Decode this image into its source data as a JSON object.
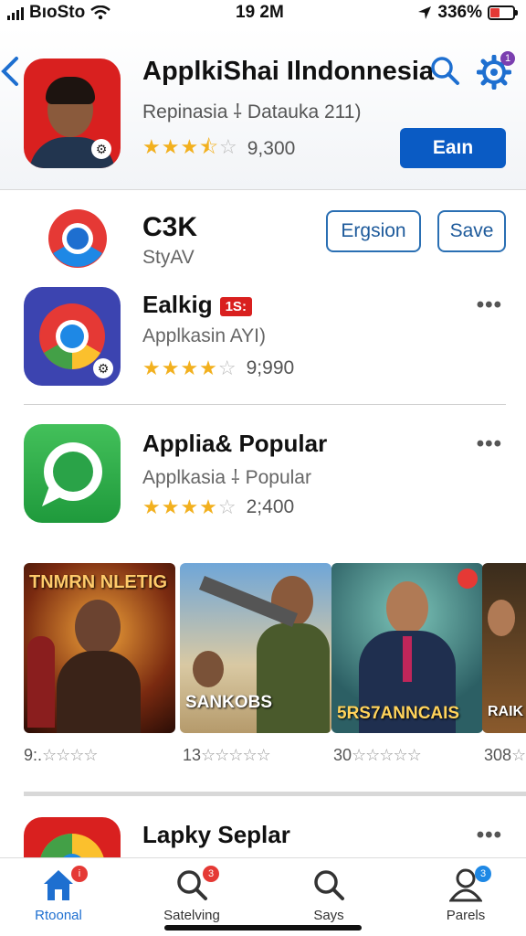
{
  "status_bar": {
    "carrier": "BıoSto",
    "time": "19 2M",
    "battery": "336%"
  },
  "header": {
    "title": "ApplkiShai Ilndonnesia",
    "subtitle": "Repinasia ⸸ Datauka 211)",
    "rating_count": "9,300",
    "stars": 3.5,
    "primary_button": "Eaın",
    "settings_badge": "1"
  },
  "row_chrome": {
    "title": "C3K",
    "subtitle": "StyAV",
    "button_1": "Ergsion",
    "button_2": "Save"
  },
  "row_1": {
    "title": "Ealkig",
    "tag": "1S:",
    "subtitle": "Applkasin AYI)",
    "stars": 4,
    "rating_count": "9;990",
    "more": "•••"
  },
  "row_2": {
    "title": "Applia& Popular",
    "subtitle": "Applkasia ⸸ Popular",
    "stars": 4,
    "rating_count": "2;400",
    "more": "•••"
  },
  "carousel": [
    {
      "top_caption": "TNMRN NLETIG",
      "caption": "",
      "rating_prefix": "9:.",
      "rating_stars": "☆☆☆☆"
    },
    {
      "top_caption": "",
      "caption": "SANKOBS",
      "rating_prefix": "13",
      "rating_stars": "☆☆☆☆☆"
    },
    {
      "top_caption": "",
      "caption": "5RS7ANNCAIS",
      "rating_prefix": "30",
      "rating_stars": "☆☆☆☆☆"
    },
    {
      "top_caption": "",
      "caption": "RAIK",
      "rating_prefix": "308",
      "rating_stars": "☆"
    }
  ],
  "row_3": {
    "title": "Lapky Seplar",
    "more": "•••"
  },
  "tabs": [
    {
      "label": "Rtoonal",
      "icon": "home-icon",
      "badge": "i"
    },
    {
      "label": "Satelving",
      "icon": "search-icon",
      "badge": "3"
    },
    {
      "label": "Says",
      "icon": "search-icon",
      "badge": ""
    },
    {
      "label": "Parels",
      "icon": "person-icon",
      "badge": "3"
    }
  ],
  "colors": {
    "accent": "#0a5bc4",
    "star": "#f2b01e",
    "red": "#d9201f"
  }
}
